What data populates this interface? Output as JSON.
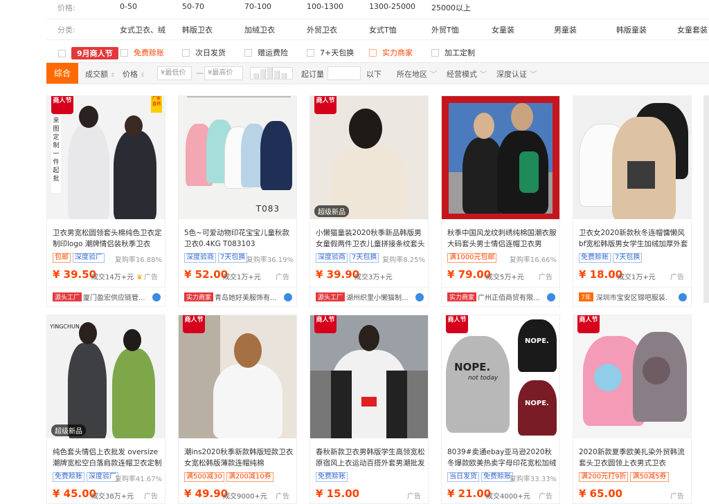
{
  "filters": {
    "price": {
      "label": "价格:",
      "options": [
        "0-50",
        "50-70",
        "70-100",
        "100-1300",
        "1300-25000",
        "25000以上"
      ]
    },
    "category": {
      "label": "分类:",
      "options": [
        "女式卫衣、绒",
        "韩版卫衣",
        "加绒卫衣",
        "外贸卫衣",
        "女式T恤",
        "外贸T恤",
        "女童装",
        "男童装",
        "韩版童装",
        "女童套装"
      ]
    }
  },
  "services": {
    "festival_badge": "9月商人节",
    "items": [
      "免费赊账",
      "次日发货",
      "赠运费险",
      "7+天包换",
      "实力商家",
      "加工定制"
    ]
  },
  "sortbar": {
    "active": "综合",
    "volume": "成交额",
    "price": "价格",
    "min_price": "¥最低价",
    "dash": "—",
    "max_price": "¥最高价",
    "moq": "起订量",
    "moq_suffix": "以下",
    "region": "所在地区",
    "mode": "经营模式",
    "depth": "深度认证"
  },
  "products": [
    {
      "title": "卫衣男宽松圆领套头棉纯色卫衣定制印logo 潮牌情侣装秋季卫衣",
      "tags": [
        {
          "t": "包邮",
          "red": true
        },
        {
          "t": "深度验厂",
          "red": false
        }
      ],
      "repeat": "复购率16.88%",
      "price": "¥ 39.50",
      "sold": "成交14万+元",
      "ad": "广告",
      "shop_badge": "源头工厂",
      "shop": "厦门盈宏供应链管...",
      "festival": "商人节",
      "factory": "厂家直销"
    },
    {
      "title": "5色~可爱动物印花宝宝儿童秋款卫衣0.4KG T083103",
      "tags": [
        {
          "t": "深度验商",
          "red": false
        },
        {
          "t": "7天包换",
          "red": false
        }
      ],
      "repeat": "复购率36.19%",
      "price": "¥ 52.00",
      "sold": "成交1万+元",
      "ad": "广告",
      "shop_badge": "实力商家",
      "shop": "青岛她好美服饰有...",
      "code": "T083"
    },
    {
      "title": "小懒猫童装2020秋季新品韩版男女童假两件卫衣儿童拼接条纹套头衫",
      "tags": [
        {
          "t": "深度验商",
          "red": false
        },
        {
          "t": "7天包换",
          "red": false
        }
      ],
      "repeat": "复购率8.25%",
      "price": "¥ 39.90",
      "sold": "成交3万+元",
      "ad": "",
      "shop_badge": "源头工厂",
      "shop": "湖州织里小懒猫制...",
      "festival": "商人节",
      "newtag": "超级新品"
    },
    {
      "title": "秋季中国风龙纹刺绣纯棉国潮衣服大码套头男士情侣连帽卫衣男",
      "tags": [
        {
          "t": "满1000元包邮",
          "red": true
        }
      ],
      "repeat": "复购率16.66%",
      "price": "¥ 79.00",
      "sold": "成交5万+元",
      "ad": "广告",
      "shop_badge": "实力商家",
      "shop": "广州正佰商贸有限..."
    },
    {
      "title": "卫衣女2020新款秋冬连帽慵懒风bf宽松韩版男女学生加绒加厚外套潮",
      "tags": [
        {
          "t": "免费赊账",
          "red": false
        },
        {
          "t": "7天包换",
          "red": false
        }
      ],
      "repeat": "",
      "price": "¥ 18.00",
      "sold": "成交1万+元",
      "ad": "广告",
      "shop_badge": "7年",
      "shop": "深圳市宝安区锦吧服装..."
    },
    {
      "title": "纯色套头情侣上衣批发 oversize潮牌宽松空白落肩款连帽卫衣定制",
      "tags": [
        {
          "t": "免费赊账",
          "red": false
        },
        {
          "t": "深度验厂",
          "red": false
        }
      ],
      "repeat": "复购率41.67%",
      "price": "¥ 45.00",
      "sold": "成交38万+元",
      "ad": "广告",
      "newtag": "超级新品",
      "brand": "YINGCHUN"
    },
    {
      "title": "潮ins2020秋季新款韩版短款卫衣女宽松韩版薄款连帽纯棉",
      "tags": [
        {
          "t": "满500减30",
          "red": true
        },
        {
          "t": "满200减10券",
          "red": true
        }
      ],
      "repeat": "",
      "price": "¥ 49.90",
      "sold": "成交9000+元",
      "ad": "广告",
      "festival": "商人节"
    },
    {
      "title": "春秋新款卫衣男韩版学生高领宽松原宿风上衣运动百搭外套男潮批发",
      "tags": [
        {
          "t": "免费赊账",
          "red": false
        }
      ],
      "repeat": "",
      "price": "¥ 15.00",
      "sold": "",
      "ad": "广告",
      "festival": "商人节"
    },
    {
      "title": "8039#卖通ebay亚马逊2020秋冬爆款欧美热卖字母印花宽松加绒卫衣",
      "tags": [
        {
          "t": "当日发货",
          "red": false
        },
        {
          "t": "免费赊账",
          "red": false
        }
      ],
      "repeat": "复购率33.33%",
      "price": "¥ 21.00",
      "sold": "成交4000+元",
      "ad": "广告",
      "festival": "商人节",
      "nope1": "NOPE.",
      "nope2": "not today"
    },
    {
      "title": "2020新款夏季欧美扎染外贸韩流套头卫衣圆领上衣男式卫衣",
      "tags": [
        {
          "t": "满200元打9折",
          "red": true
        },
        {
          "t": "满50减5券",
          "red": true
        }
      ],
      "repeat": "",
      "price": "¥ 65.00",
      "sold": "",
      "ad": "广告",
      "festival": "商人节"
    }
  ]
}
